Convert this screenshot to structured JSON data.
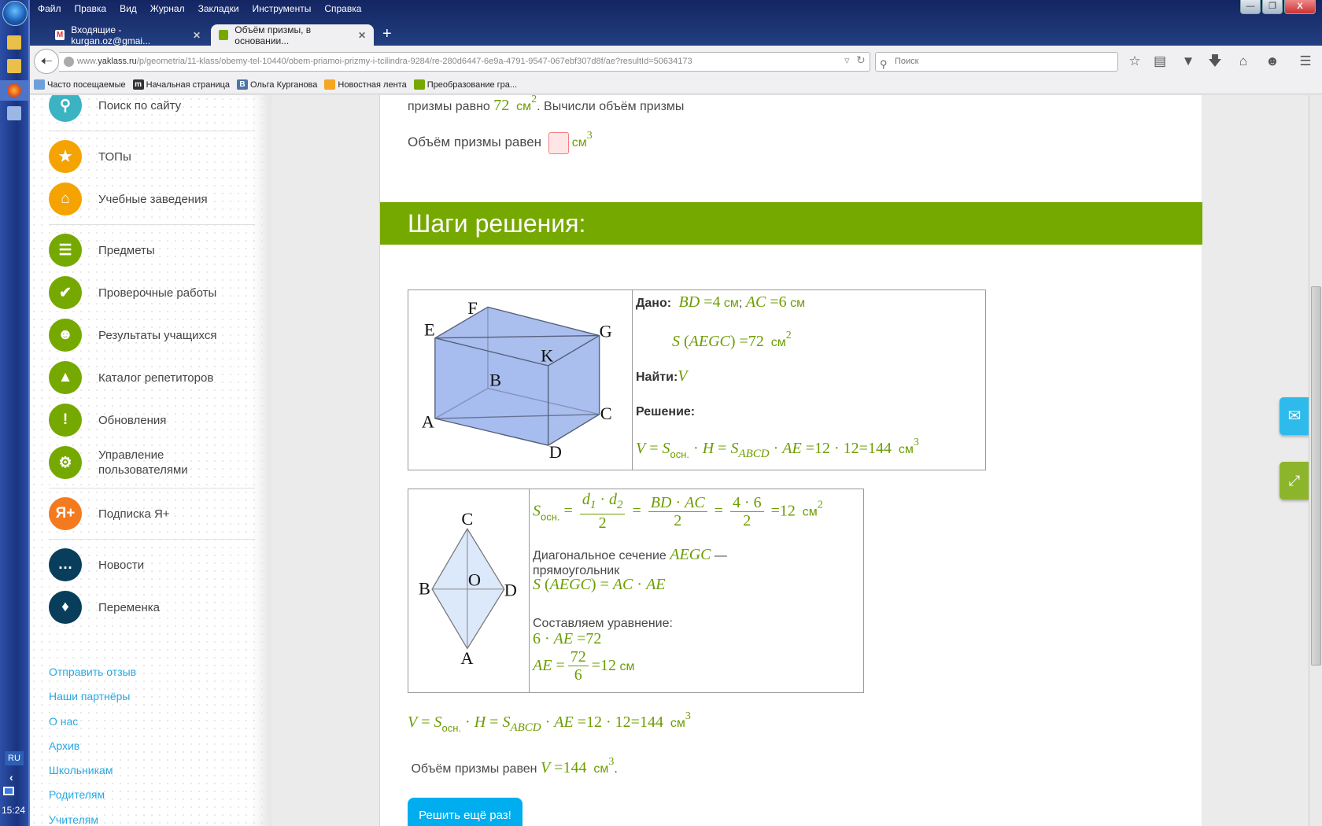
{
  "browser": {
    "menu": [
      "Файл",
      "Правка",
      "Вид",
      "Журнал",
      "Закладки",
      "Инструменты",
      "Справка"
    ],
    "tabs": [
      {
        "title": "Входящие - kurgan.oz@gmai...",
        "active": false
      },
      {
        "title": "Объём призмы, в основании...",
        "active": true
      }
    ],
    "url_prefix": "www.",
    "url_domain": "yaklass.ru",
    "url_path": "/p/geometria/11-klass/obemy-tel-10440/obem-priamoi-prizmy-i-tcilindra-9284/re-280d6447-6e9a-4791-9547-067ebf307d8f/ae?resultId=50634173",
    "search_placeholder": "Поиск",
    "bookmarks": [
      "Часто посещаемые",
      "Начальная страница",
      "Ольга Курганова",
      "Новостная лента",
      "Преобразование гра..."
    ]
  },
  "taskbar": {
    "lang": "RU",
    "time": "15:24"
  },
  "sidebar": {
    "items": [
      {
        "label": "Поиск по сайту",
        "icon": "search-icon",
        "color": "#3bb3c3"
      },
      {
        "divider": true
      },
      {
        "label": "ТОПы",
        "icon": "star-icon",
        "color": "#f5a300"
      },
      {
        "label": "Учебные заведения",
        "icon": "institution-icon",
        "color": "#f5a300"
      },
      {
        "divider": true
      },
      {
        "label": "Предметы",
        "icon": "book-icon",
        "color": "#76a900"
      },
      {
        "label": "Проверочные работы",
        "icon": "check-icon",
        "color": "#76a900"
      },
      {
        "label": "Результаты учащихся",
        "icon": "users-icon",
        "color": "#76a900"
      },
      {
        "label": "Каталог репетиторов",
        "icon": "graduation-cap-icon",
        "color": "#76a900"
      },
      {
        "label": "Обновления",
        "icon": "exclamation-icon",
        "color": "#76a900"
      },
      {
        "label": "Управление пользователями",
        "icon": "user-gear-icon",
        "color": "#76a900"
      },
      {
        "divider": true
      },
      {
        "label": "Подписка Я+",
        "icon": "ya-plus-icon",
        "color": "#f47a20"
      },
      {
        "divider": true
      },
      {
        "label": "Новости",
        "icon": "chat-icon",
        "color": "#083e5c"
      },
      {
        "label": "Переменка",
        "icon": "bell-icon",
        "color": "#083e5c"
      }
    ],
    "footer_links": [
      "Отправить отзыв",
      "Наши партнёры",
      "О нас",
      "Архив",
      "Школьникам",
      "Родителям",
      "Учителям"
    ]
  },
  "task": {
    "line1": [
      {
        "k": "t",
        "t": "призмы равно "
      },
      {
        "k": "mo",
        "t": "72"
      },
      {
        "k": "u",
        "t": "  см"
      },
      {
        "k": "sup",
        "t": "2"
      },
      {
        "k": "t",
        "t": ". Вычисли объём призмы"
      }
    ],
    "answer_label": "Объём призмы равен ",
    "answer_unit": "см",
    "answer_unit_power": "3",
    "steps_title": "Шаги решения:",
    "retry_button": "Решить ещё раз!"
  },
  "diagrams": {
    "prism": {
      "E": "E",
      "F": "F",
      "G": "G",
      "K": "K",
      "A": "A",
      "B": "B",
      "C": "C",
      "D": "D"
    },
    "rhombus": {
      "C": "C",
      "B": "B",
      "O": "O",
      "D": "D",
      "A": "A"
    }
  },
  "formulas": {
    "given": [
      {
        "k": "b",
        "t": "Дано: "
      },
      {
        "k": "mi",
        "t": " BD"
      },
      {
        "k": "mo",
        "t": " =4"
      },
      {
        "k": "u",
        "t": " см"
      },
      {
        "k": "t",
        "t": "; "
      },
      {
        "k": "mi",
        "t": "AC"
      },
      {
        "k": "mo",
        "t": " =6"
      },
      {
        "k": "u",
        "t": " см"
      }
    ],
    "area": [
      {
        "k": "mi",
        "t": "S"
      },
      {
        "k": "mo",
        "t": " ("
      },
      {
        "k": "mi",
        "t": "AEGC"
      },
      {
        "k": "mo",
        "t": ") =72"
      },
      {
        "k": "u",
        "t": "  см"
      },
      {
        "k": "sup",
        "t": "2"
      }
    ],
    "find": [
      {
        "k": "b",
        "t": "Найти:"
      },
      {
        "k": "mi",
        "t": "V"
      }
    ],
    "solution": [
      {
        "k": "b",
        "t": "Решение:"
      }
    ],
    "volume": [
      {
        "k": "mi",
        "t": "V"
      },
      {
        "k": "mo",
        "t": " = "
      },
      {
        "k": "mi",
        "t": "S"
      },
      {
        "k": "subs",
        "t": "осн."
      },
      {
        "k": "mo",
        "t": " · "
      },
      {
        "k": "mi",
        "t": "H"
      },
      {
        "k": "mo",
        "t": " = "
      },
      {
        "k": "mi",
        "t": "S"
      },
      {
        "k": "subi",
        "t": "ABCD"
      },
      {
        "k": "mo",
        "t": " · "
      },
      {
        "k": "mi",
        "t": "AE"
      },
      {
        "k": "mo",
        "t": " =12 · 12=144"
      },
      {
        "k": "u",
        "t": "  см"
      },
      {
        "k": "sup",
        "t": "3"
      }
    ],
    "base_area": [
      {
        "k": "mi",
        "t": "S"
      },
      {
        "k": "subs",
        "t": "осн."
      },
      {
        "k": "mo",
        "t": " = "
      },
      {
        "k": "frac",
        "num": [
          {
            "k": "mi",
            "t": "d"
          },
          {
            "k": "subi",
            "t": "1"
          },
          {
            "k": "mo",
            "t": " · "
          },
          {
            "k": "mi",
            "t": "d"
          },
          {
            "k": "subi",
            "t": "2"
          }
        ],
        "den": [
          {
            "k": "mo",
            "t": "2"
          }
        ]
      },
      {
        "k": "mo",
        "t": " = "
      },
      {
        "k": "frac",
        "num": [
          {
            "k": "mi",
            "t": "BD"
          },
          {
            "k": "mo",
            "t": " · "
          },
          {
            "k": "mi",
            "t": "AC"
          }
        ],
        "den": [
          {
            "k": "mo",
            "t": "2"
          }
        ]
      },
      {
        "k": "mo",
        "t": " = "
      },
      {
        "k": "frac",
        "num": [
          {
            "k": "mo",
            "t": "4 · 6"
          }
        ],
        "den": [
          {
            "k": "mo",
            "t": "2"
          }
        ]
      },
      {
        "k": "mo",
        "t": " =12"
      },
      {
        "k": "u",
        "t": "  см"
      },
      {
        "k": "sup",
        "t": "2"
      }
    ],
    "diag1": [
      {
        "k": "t",
        "t": "Диагональное сечение "
      },
      {
        "k": "mi",
        "t": "AEGC"
      },
      {
        "k": "t",
        "t": " —"
      }
    ],
    "diag2": [
      {
        "k": "t",
        "t": "прямоугольник"
      }
    ],
    "rect": [
      {
        "k": "mi",
        "t": "S"
      },
      {
        "k": "mo",
        "t": " ("
      },
      {
        "k": "mi",
        "t": "AEGC"
      },
      {
        "k": "mo",
        "t": ") = "
      },
      {
        "k": "mi",
        "t": "AC"
      },
      {
        "k": "mo",
        "t": " · "
      },
      {
        "k": "mi",
        "t": "AE"
      }
    ],
    "eq_label": [
      {
        "k": "t",
        "t": "Составляем уравнение:"
      }
    ],
    "eq1": [
      {
        "k": "mo",
        "t": "6 · "
      },
      {
        "k": "mi",
        "t": "AE"
      },
      {
        "k": "mo",
        "t": " =72"
      }
    ],
    "eq2": [
      {
        "k": "mi",
        "t": "AE"
      },
      {
        "k": "mo",
        "t": " ="
      },
      {
        "k": "frac",
        "num": [
          {
            "k": "mo",
            "t": "72"
          }
        ],
        "den": [
          {
            "k": "mo",
            "t": "6"
          }
        ]
      },
      {
        "k": "mo",
        "t": "=12"
      },
      {
        "k": "u",
        "t": " см"
      }
    ],
    "final": [
      {
        "k": "mi",
        "t": "V"
      },
      {
        "k": "mo",
        "t": " = "
      },
      {
        "k": "mi",
        "t": "S"
      },
      {
        "k": "subs",
        "t": "осн."
      },
      {
        "k": "mo",
        "t": " · "
      },
      {
        "k": "mi",
        "t": "H"
      },
      {
        "k": "mo",
        "t": " = "
      },
      {
        "k": "mi",
        "t": "S"
      },
      {
        "k": "subi",
        "t": "ABCD"
      },
      {
        "k": "mo",
        "t": " · "
      },
      {
        "k": "mi",
        "t": "AE"
      },
      {
        "k": "mo",
        "t": " =12 · 12=144"
      },
      {
        "k": "u",
        "t": "  см"
      },
      {
        "k": "sup",
        "t": "3"
      }
    ],
    "conclusion": [
      {
        "k": "t",
        "t": " Объём призмы равен "
      },
      {
        "k": "mi",
        "t": "V"
      },
      {
        "k": "mo",
        "t": " =144"
      },
      {
        "k": "u",
        "t": "  см"
      },
      {
        "k": "sup",
        "t": "3"
      },
      {
        "k": "t",
        "t": "."
      }
    ]
  },
  "colors": {
    "accent_green": "#76a900",
    "math_green": "#6c9d00",
    "button_blue": "#00aeef",
    "link_blue": "#29a8e0"
  }
}
